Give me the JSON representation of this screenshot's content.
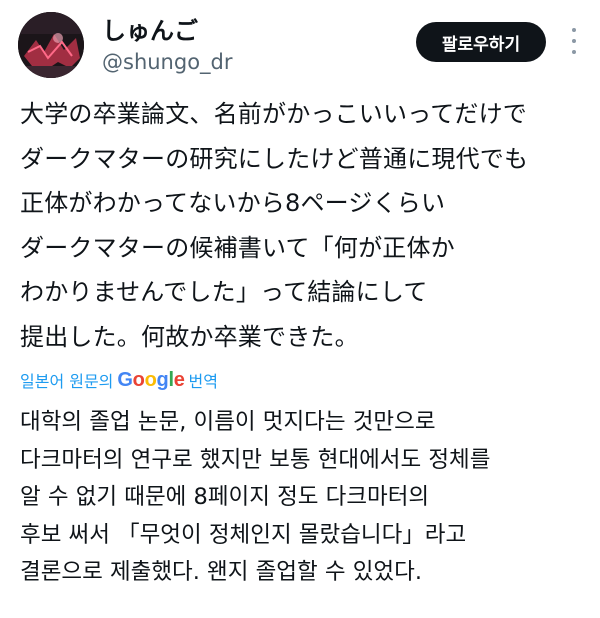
{
  "user": {
    "display_name": "しゅんご",
    "handle": "@shungo_dr",
    "follow_label": "팔로우하기"
  },
  "tweet": {
    "lines": [
      "大学の卒業論文、名前がかっこいいってだけで",
      "ダークマターの研究にしたけど普通に現代でも",
      "正体がわかってないから8ページくらい",
      "ダークマターの候補書いて「何が正体か",
      "わかりませんでした」って結論にして",
      "提出した。何故か卒業できた。"
    ]
  },
  "translation": {
    "prefix": "일본어 원문의",
    "google_letters": [
      {
        "ch": "G",
        "color": "#4285F4"
      },
      {
        "ch": "o",
        "color": "#EA4335"
      },
      {
        "ch": "o",
        "color": "#FBBC05"
      },
      {
        "ch": "g",
        "color": "#4285F4"
      },
      {
        "ch": "l",
        "color": "#34A853"
      },
      {
        "ch": "e",
        "color": "#EA4335"
      }
    ],
    "suffix": "번역",
    "lines": [
      "대학의 졸업 논문, 이름이 멋지다는 것만으로",
      "다크마터의 연구로 했지만 보통 현대에서도 정체를",
      "알 수 없기 때문에 8페이지 정도 다크마터의",
      "후보 써서 「무엇이 정체인지 몰랐습니다」라고",
      "결론으로 제출했다. 왠지 졸업할 수 있었다."
    ]
  },
  "colors": {
    "link": "#1d9bf0",
    "secondary_text": "#536471",
    "button_bg": "#0f1419"
  },
  "icons": {
    "more": "more-dots-vertical-icon",
    "avatar": "profile-avatar"
  }
}
